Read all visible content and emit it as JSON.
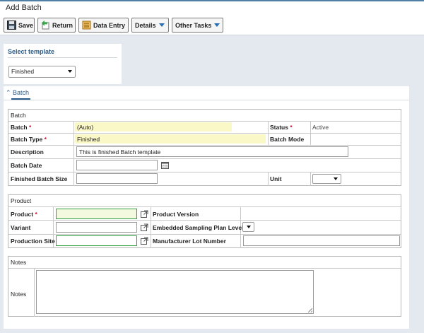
{
  "window": {
    "title": "Add Batch"
  },
  "toolbar": {
    "save": "Save",
    "return": "Return",
    "data_entry": "Data Entry",
    "details": "Details",
    "other_tasks": "Other Tasks"
  },
  "template": {
    "title": "Select template",
    "selected": "Finished"
  },
  "tab": {
    "label": "Batch"
  },
  "batch": {
    "section_title": "Batch",
    "batch_label": "Batch",
    "batch_value": "(Auto)",
    "status_label": "Status",
    "status_value": "Active",
    "batch_type_label": "Batch Type",
    "batch_type_value": "Finished",
    "batch_mode_label": "Batch Mode",
    "description_label": "Description",
    "description_value": "This is finished Batch template",
    "batch_date_label": "Batch Date",
    "finished_size_label": "Finished Batch Size",
    "unit_label": "Unit"
  },
  "product": {
    "section_title": "Product",
    "product_label": "Product",
    "product_version_label": "Product Version",
    "variant_label": "Variant",
    "sampling_label": "Embedded Sampling Plan Level",
    "production_site_label": "Production Site",
    "manufacturer_lot_label": "Manufacturer Lot Number"
  },
  "notes": {
    "section_title": "Notes",
    "notes_label": "Notes"
  },
  "colors": {
    "accent": "#2b5a86",
    "required": "#c8102e",
    "highlight": "#fbf8c8",
    "required_field_border": "#33a043",
    "background": "#e4e9f0"
  }
}
